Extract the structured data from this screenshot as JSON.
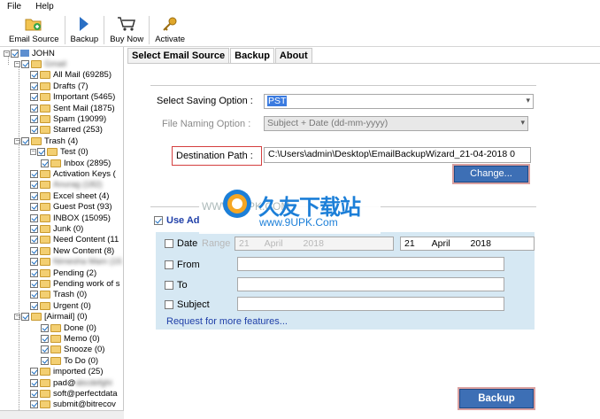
{
  "menu": {
    "file": "File",
    "help": "Help"
  },
  "toolbar": {
    "email_source": "Email Source",
    "backup": "Backup",
    "buy_now": "Buy Now",
    "activate": "Activate"
  },
  "tree": {
    "root": "JOHN",
    "account": "Gmail",
    "items": [
      {
        "label": "All Mail (69285)",
        "indent": 2
      },
      {
        "label": "Drafts (7)",
        "indent": 2
      },
      {
        "label": "Important (5465)",
        "indent": 2
      },
      {
        "label": "Sent Mail (1875)",
        "indent": 2
      },
      {
        "label": "Spam (19099)",
        "indent": 2
      },
      {
        "label": "Starred (253)",
        "indent": 2
      },
      {
        "label": "Trash (4)",
        "indent": 1
      },
      {
        "label": "Test (0)",
        "indent": 2
      },
      {
        "label": "Inbox (2895)",
        "indent": 3
      },
      {
        "label": "Activation Keys (",
        "indent": 2
      },
      {
        "label": "Anurag (182)",
        "indent": 2,
        "blur_prefix": "Anurag"
      },
      {
        "label": "Excel sheet (4)",
        "indent": 2
      },
      {
        "label": "Guest Post (93)",
        "indent": 2
      },
      {
        "label": "INBOX (15095)",
        "indent": 2
      },
      {
        "label": "Junk (0)",
        "indent": 2
      },
      {
        "label": "Need Content (11",
        "indent": 2
      },
      {
        "label": "New Content (8)",
        "indent": 2
      },
      {
        "label": "Nimesha Mam (15",
        "indent": 2,
        "blur_prefix": "Nimesha Mam"
      },
      {
        "label": "Pending (2)",
        "indent": 2
      },
      {
        "label": "Pending work of s",
        "indent": 2
      },
      {
        "label": "Trash (0)",
        "indent": 2
      },
      {
        "label": "Urgent (0)",
        "indent": 2
      },
      {
        "label": "[Airmail] (0)",
        "indent": 1
      },
      {
        "label": "Done (0)",
        "indent": 3
      },
      {
        "label": "Memo (0)",
        "indent": 3
      },
      {
        "label": "Snooze (0)",
        "indent": 3
      },
      {
        "label": "To Do (0)",
        "indent": 3
      },
      {
        "label": "imported (25)",
        "indent": 2
      },
      {
        "label": "pad@",
        "indent": 2,
        "blur_suffix": "abcdefghi"
      },
      {
        "label": "soft@perfectdata",
        "indent": 2
      },
      {
        "label": "submit@bitrecov",
        "indent": 2
      }
    ]
  },
  "tabs": [
    "Select Email Source",
    "Backup",
    "About"
  ],
  "form": {
    "saving_option_label": "Select Saving Option :",
    "saving_option_value": "PST",
    "file_naming_label": "File Naming Option :",
    "file_naming_value": "Subject + Date (dd-mm-yyyy)",
    "destination_label": "Destination Path :",
    "destination_value": "C:\\Users\\admin\\Desktop\\EmailBackupWizard_21-04-2018 0",
    "change_button": "Change...",
    "use_advance": "Use Ad",
    "date_label": "Date",
    "date_range_faint": "Range",
    "date_from": {
      "day": "21",
      "month": "April",
      "year": "2018"
    },
    "date_to": {
      "day": "21",
      "month": "April",
      "year": "2018"
    },
    "from_label": "From",
    "to_label": "To",
    "subject_label": "Subject",
    "request_link": "Request for more features...",
    "backup_button": "Backup"
  },
  "watermark": {
    "title": "久友下载站",
    "url": "www.9UPK.Com",
    "faint": "WWW.9UPK.COM"
  },
  "colors": {
    "accent": "#3d6fb5",
    "panel": "#d6e8f3",
    "link": "#1f3fa8",
    "highlight_border": "#d43f3f"
  }
}
